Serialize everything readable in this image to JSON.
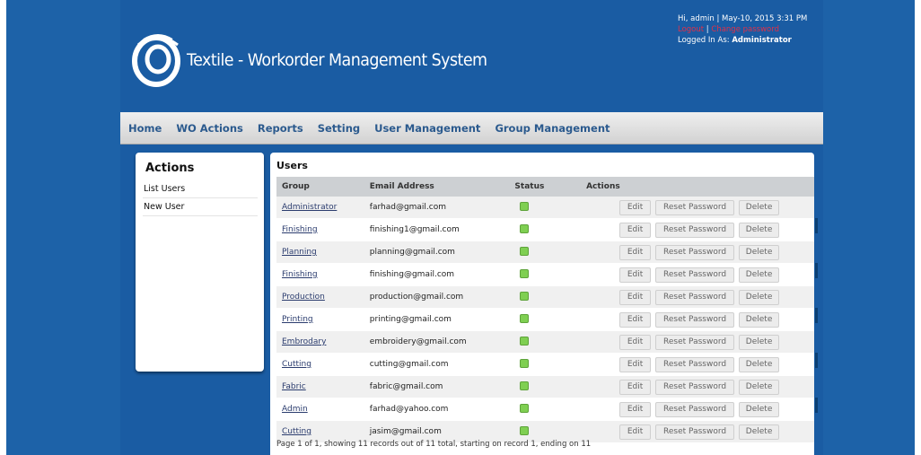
{
  "header": {
    "app_title": "Textile - Workorder Management System",
    "greeting": "Hi, admin | May-10, 2015 3:31 PM",
    "logout_label": "Logout",
    "separator": " | ",
    "change_password_label": "Change password",
    "logged_in_prefix": "Logged In As: ",
    "logged_in_role": "Administrator"
  },
  "nav": {
    "items": [
      "Home",
      "WO Actions",
      "Reports",
      "Setting",
      "User Management",
      "Group Management"
    ]
  },
  "sidebar": {
    "title": "Actions",
    "items": [
      "List Users",
      "New User"
    ]
  },
  "main": {
    "title": "Users",
    "columns": [
      "Group",
      "Email Address",
      "Status",
      "Actions"
    ],
    "buttons": {
      "edit": "Edit",
      "reset": "Reset Password",
      "delete": "Delete"
    },
    "rows": [
      {
        "group": "Administrator",
        "email": "farhad@gmail.com",
        "active": true
      },
      {
        "group": "Finishing",
        "email": "finishing1@gmail.com",
        "active": true
      },
      {
        "group": "Planning",
        "email": "planning@gmail.com",
        "active": true
      },
      {
        "group": "Finishing",
        "email": "finishing@gmail.com",
        "active": true
      },
      {
        "group": "Production",
        "email": "production@gmail.com",
        "active": true
      },
      {
        "group": "Printing",
        "email": "printing@gmail.com",
        "active": true
      },
      {
        "group": "Embrodary",
        "email": "embroidery@gmail.com",
        "active": true
      },
      {
        "group": "Cutting",
        "email": "cutting@gmail.com",
        "active": true
      },
      {
        "group": "Fabric",
        "email": "fabric@gmail.com",
        "active": true
      },
      {
        "group": "Admin",
        "email": "farhad@yahoo.com",
        "active": true
      },
      {
        "group": "Cutting",
        "email": "jasim@gmail.com",
        "active": true
      }
    ],
    "pagination": "Page 1 of 1, showing 11 records out of 11 total, starting on record 1, ending on 11"
  },
  "colors": {
    "background_blue": "#1d62a8",
    "nav_text": "#2b5a8e",
    "status_active": "#7fcf52",
    "link_red": "#e03048"
  },
  "icons": {
    "logo": "swirl-logo-icon",
    "status": "status-active-icon"
  }
}
